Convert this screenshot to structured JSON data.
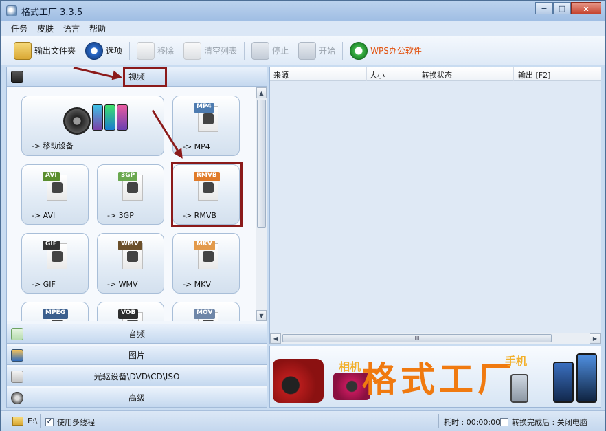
{
  "window": {
    "title": "格式工厂 3.3.5"
  },
  "window_controls": {
    "minimize": "−",
    "maximize": "□",
    "close": "x"
  },
  "menu": [
    "任务",
    "皮肤",
    "语言",
    "帮助"
  ],
  "toolbar": {
    "output_folder": "输出文件夹",
    "options": "选项",
    "remove": "移除",
    "clear_list": "清空列表",
    "stop": "停止",
    "start": "开始",
    "wps": "WPS办公软件"
  },
  "categories": {
    "video": "视频",
    "audio": "音频",
    "image": "图片",
    "disc": "光驱设备\\DVD\\CD\\ISO",
    "advanced": "高级"
  },
  "tiles": [
    {
      "label": "-> 移动设备"
    },
    {
      "badge": "MP4",
      "label": "-> MP4"
    },
    {
      "badge": "AVI",
      "label": "-> AVI"
    },
    {
      "badge": "3GP",
      "label": "-> 3GP"
    },
    {
      "badge": "RMVB",
      "label": "-> RMVB"
    },
    {
      "badge": "GIF",
      "label": "-> GIF"
    },
    {
      "badge": "WMV",
      "label": "-> WMV"
    },
    {
      "badge": "MKV",
      "label": "-> MKV"
    },
    {
      "badge": "MPEG"
    },
    {
      "badge": "VOB"
    },
    {
      "badge": "MOV"
    }
  ],
  "list_columns": [
    "来源",
    "大小",
    "转换状态",
    "输出 [F2]"
  ],
  "scroll": {
    "up": "▲",
    "down": "▼",
    "left": "◀",
    "right": "▶",
    "grip": "III"
  },
  "banner": {
    "title": "格式工厂",
    "camera": "相机",
    "phone": "手机"
  },
  "status": {
    "drive": "E:\\",
    "multithread_check": "✓",
    "multithread": "使用多线程",
    "elapsed": "耗时 : 00:00:00",
    "after_done": "转换完成后 : 关闭电脑"
  }
}
